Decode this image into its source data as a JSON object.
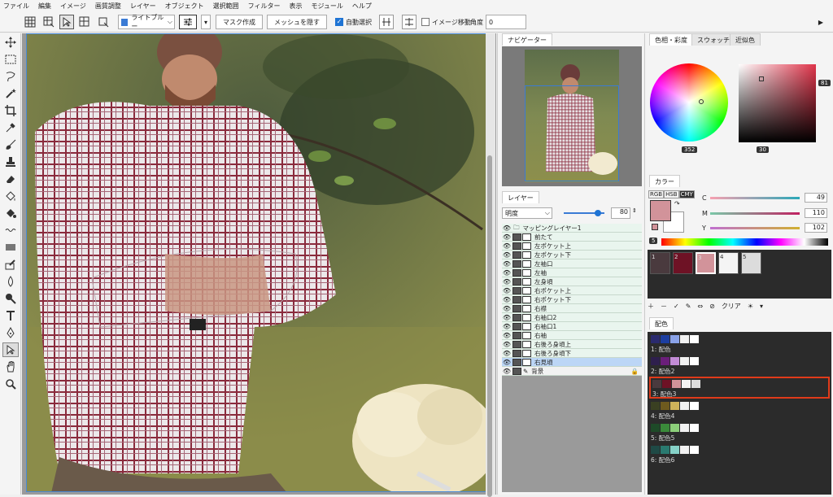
{
  "menu": [
    "ファイル",
    "編集",
    "イメージ",
    "画質調整",
    "レイヤー",
    "オブジェクト",
    "選択範囲",
    "フィルター",
    "表示",
    "モジュール",
    "ヘルプ"
  ],
  "toolbar": {
    "color_select": "ライトブルー",
    "mask_btn": "マスク作成",
    "mesh_btn": "メッシュを隠す",
    "auto_select": "自動選択",
    "image_move": "イメージ移動",
    "angle_label": "角度",
    "angle_value": "0"
  },
  "navigator": {
    "tab": "ナビゲーター"
  },
  "layers": {
    "tab": "レイヤー",
    "blend_mode": "明度",
    "opacity": "80",
    "items": [
      {
        "name": "マッピングレイヤー1",
        "type": "folder"
      },
      {
        "name": "前たて"
      },
      {
        "name": "左ポケット上"
      },
      {
        "name": "左ポケット下"
      },
      {
        "name": "左袖口"
      },
      {
        "name": "左袖"
      },
      {
        "name": "左身頃"
      },
      {
        "name": "右ポケット上"
      },
      {
        "name": "右ポケット下"
      },
      {
        "name": "右襟"
      },
      {
        "name": "右袖口2"
      },
      {
        "name": "右袖口1"
      },
      {
        "name": "右袖"
      },
      {
        "name": "右後ろ身頃上"
      },
      {
        "name": "右後ろ身頃下"
      },
      {
        "name": "右見頃",
        "selected": true
      },
      {
        "name": "背景",
        "background": true
      }
    ]
  },
  "color": {
    "tabs": [
      "色相・彩度",
      "スウォッチ",
      "近似色"
    ],
    "hue_value": "352",
    "sat_value": "81",
    "bright_value": "30",
    "color_tab": "カラー",
    "modes": [
      "RGB",
      "HSB",
      "CMY"
    ],
    "sliders": [
      {
        "label": "C",
        "value": "49"
      },
      {
        "label": "M",
        "value": "110"
      },
      {
        "label": "Y",
        "value": "102"
      }
    ],
    "scale_value": "5"
  },
  "swatches": [
    {
      "label": "1",
      "color": "#4a3a3e"
    },
    {
      "label": "2",
      "color": "#6e1225"
    },
    {
      "label": "3",
      "color": "#d2939a"
    },
    {
      "label": "4",
      "color": "#f4f4f4"
    },
    {
      "label": "5",
      "color": "#dcdcdc"
    }
  ],
  "palette_bar": {
    "clear": "クリア"
  },
  "schemes": {
    "tab": "配色",
    "items": [
      {
        "name": "1: 配色",
        "colors": [
          "#2a2a6e",
          "#1c3ea0",
          "#8aa2e8",
          "#f2f2f2",
          "#ffffff"
        ]
      },
      {
        "name": "2: 配色2",
        "colors": [
          "#2e1f4d",
          "#6a1e7a",
          "#c28cd6",
          "#f2f2f2",
          "#ffffff"
        ]
      },
      {
        "name": "3: 配色3",
        "colors": [
          "#4a3a3e",
          "#6e1225",
          "#d2939a",
          "#f4f4f4",
          "#dcdcdc"
        ],
        "highlighted": true
      },
      {
        "name": "4: 配色4",
        "colors": [
          "#3a4022",
          "#6e5a1e",
          "#cfb25a",
          "#f2f2f2",
          "#ffffff"
        ]
      },
      {
        "name": "5: 配色5",
        "colors": [
          "#1e4a28",
          "#3a8a3a",
          "#8ccf7a",
          "#f2f2f2",
          "#ffffff"
        ]
      },
      {
        "name": "6: 配色6",
        "colors": [
          "#1f4a46",
          "#2a7a70",
          "#86d2c8",
          "#f2f2f2",
          "#ffffff"
        ]
      }
    ]
  }
}
